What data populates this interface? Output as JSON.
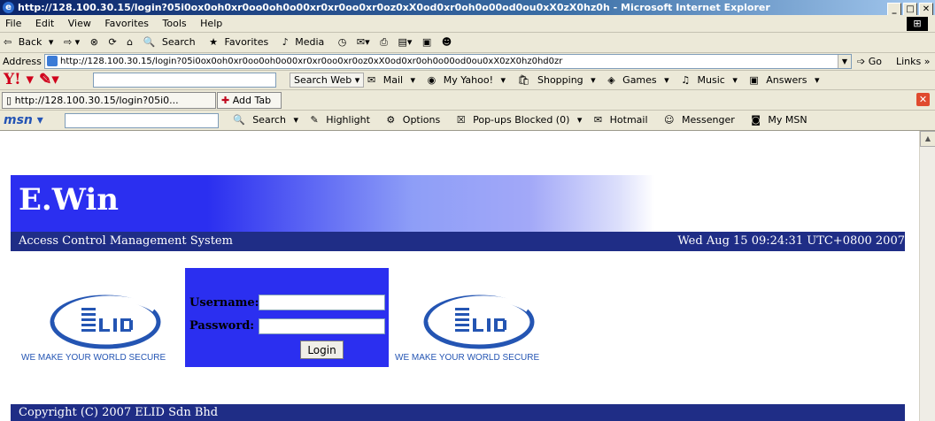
{
  "window": {
    "title": "http://128.100.30.15/login?05i0ox0oh0xr0oo0oh0o00xr0xr0oo0xr0oz0xX0od0xr0oh0o00od0ou0xX0zX0hz0h - Microsoft Internet Explorer"
  },
  "menubar": [
    "File",
    "Edit",
    "View",
    "Favorites",
    "Tools",
    "Help"
  ],
  "toolbar": [
    "Back",
    "Search",
    "Favorites",
    "Media"
  ],
  "address": {
    "label": "Address",
    "url": "http://128.100.30.15/login?05i0ox0oh0xr0oo0oh0o00xr0xr0oo0xr0oz0xX0od0xr0oh0o00od0ou0xX0zX0hz0hd0zr",
    "go": "Go",
    "links": "Links"
  },
  "yahoo": {
    "search_btn": "Search Web",
    "items": [
      "Mail",
      "My Yahoo!",
      "Shopping",
      "Games",
      "Music",
      "Answers"
    ]
  },
  "tabs": {
    "current": "http://128.100.30.15/login?05i0...",
    "add": "Add Tab"
  },
  "msn": {
    "items": [
      "Search",
      "Highlight",
      "Options",
      "Pop-ups Blocked (0)",
      "Hotmail",
      "Messenger",
      "My MSN"
    ]
  },
  "page": {
    "brand": "E.Win",
    "subtitle": "Access Control Management System",
    "datetime": "Wed Aug 15 09:24:31 UTC+0800 2007",
    "logo_tagline": "WE MAKE YOUR WORLD SECURE",
    "username_label": "Username:",
    "password_label": "Password:",
    "login_button": "Login",
    "copyright": "Copyright (C) 2007 ELID Sdn Bhd"
  }
}
